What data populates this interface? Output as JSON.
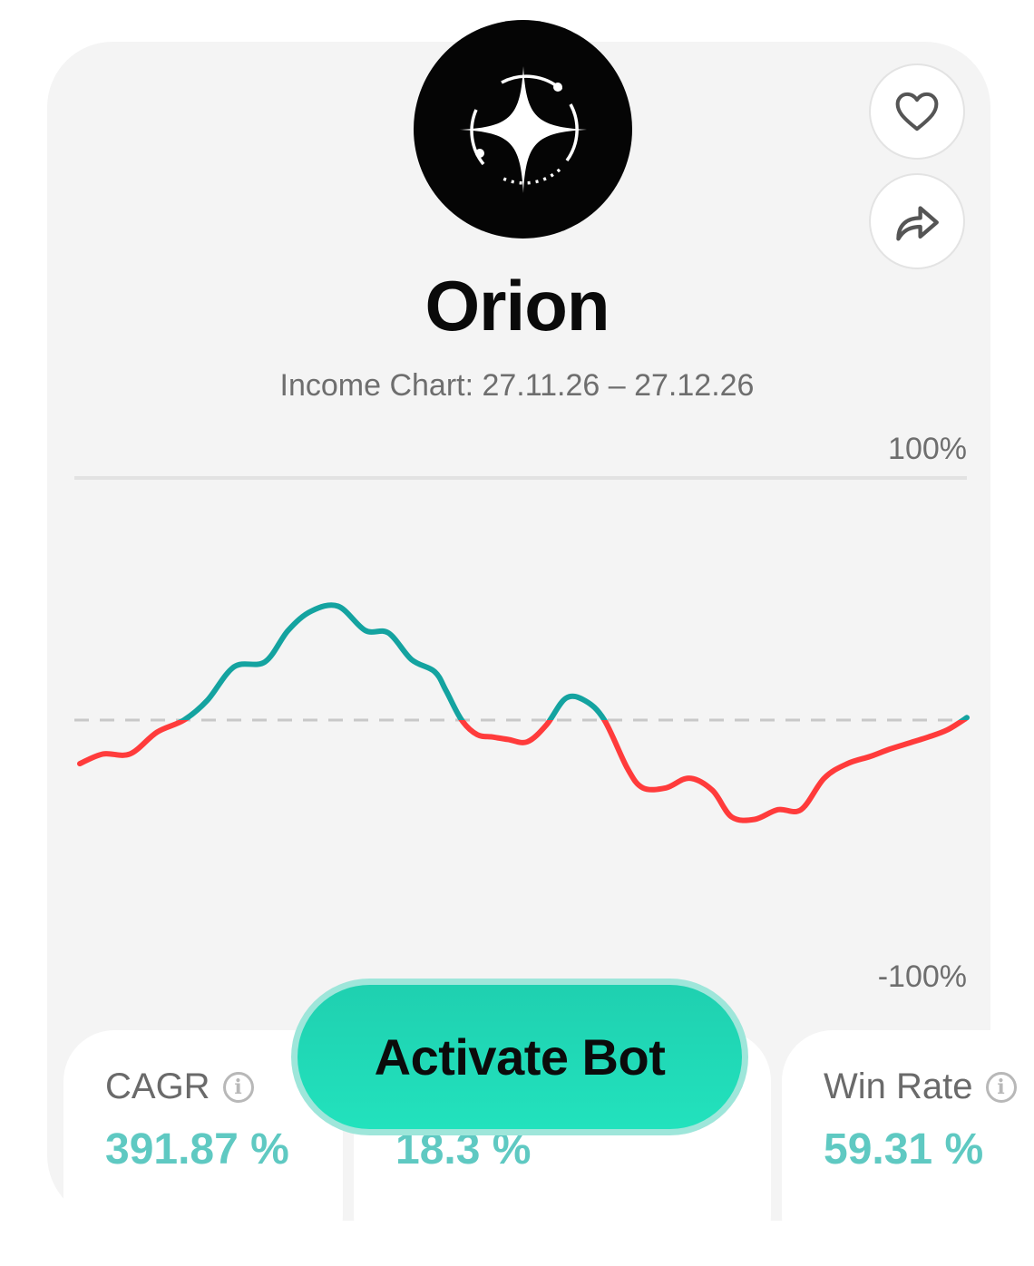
{
  "bot": {
    "name": "Orion",
    "subtitle": "Income Chart: 27.11.26 – 27.12.26"
  },
  "actions": {
    "favorite_icon": "heart-icon",
    "share_icon": "share-arrow-icon",
    "activate_label": "Activate Bot"
  },
  "chart_data": {
    "type": "line",
    "title": "",
    "ylim": [
      -100,
      100
    ],
    "y_top_label": "100%",
    "y_bottom_label": "-100%",
    "baseline": 0,
    "positive_color": "#14a3a0",
    "negative_color": "#ff3b3b",
    "series": [
      {
        "x": [
          0,
          6,
          13,
          20,
          27,
          33,
          40,
          48,
          54,
          60,
          67,
          74,
          80,
          86,
          92,
          95,
          99,
          103,
          107,
          111,
          116,
          121,
          126,
          131,
          136,
          142,
          146,
          152,
          158,
          164,
          169,
          175,
          181,
          187,
          193,
          199,
          205,
          210,
          216,
          220,
          225,
          230
        ],
        "y": [
          -18,
          -14,
          -14,
          -5,
          0,
          8,
          22,
          24,
          37,
          45,
          47,
          37,
          36,
          25,
          20,
          12,
          0,
          -6,
          -7,
          -8,
          -9,
          -2,
          9,
          8,
          0,
          -20,
          -28,
          -28,
          -24,
          -29,
          -40,
          -41,
          -37,
          -37,
          -24,
          -18,
          -15,
          -12,
          -9,
          -7,
          -4,
          1
        ]
      }
    ]
  },
  "stats": [
    {
      "label": "CAGR",
      "value": "391.87 %"
    },
    {
      "label": "",
      "value": "18.3 %"
    },
    {
      "label": "Win Rate",
      "value": "59.31 %"
    }
  ]
}
